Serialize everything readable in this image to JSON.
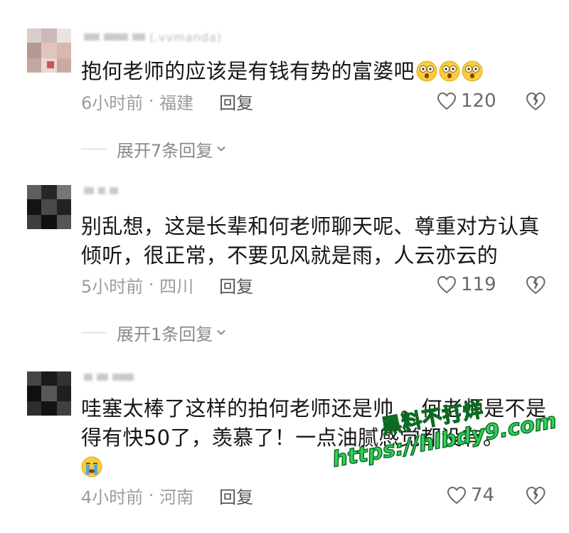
{
  "comments": [
    {
      "username": "(.vvmanda)",
      "text": "抱何老师的应该是有钱有势的富婆吧",
      "emoji_count": 3,
      "time": "6小时前",
      "location": "福建",
      "reply_label": "回复",
      "likes": "120",
      "expand_label": "展开7条回复"
    },
    {
      "username": "",
      "text": "别乱想，这是长辈和何老师聊天呢、尊重对方认真倾听，很正常，不要见风就是雨，人云亦云的",
      "time": "5小时前",
      "location": "四川",
      "reply_label": "回复",
      "likes": "119",
      "expand_label": "展开1条回复"
    },
    {
      "username": "",
      "text": "哇塞太棒了这样的拍何老师还是帅 。何老师是不是得有快50了，羡慕了！一点油腻感觉都没有。",
      "time": "4小时前",
      "location": "河南",
      "reply_label": "回复",
      "likes": "74"
    }
  ],
  "watermark": {
    "line1": "黑料不打烊",
    "line2": "https://hlbdy9.com"
  },
  "icons": {
    "like": "heart-outline-icon",
    "dislike": "broken-heart-icon",
    "expand": "chevron-down-icon",
    "emoji": "shocked-face-emoji-icon"
  },
  "colors": {
    "watermark_green": "#2fd35a",
    "meta_gray": "#9c9c9c"
  }
}
